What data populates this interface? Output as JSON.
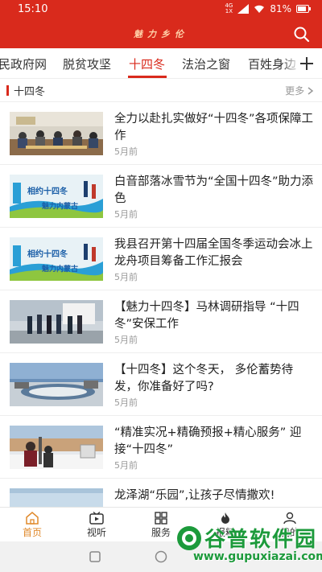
{
  "status_bar": {
    "time": "15:10",
    "network_top": "4G",
    "network_bottom": "1X",
    "battery": "81%"
  },
  "header": {
    "title": "魅力乡伦"
  },
  "tabs": [
    {
      "label": "民政府网",
      "active": false
    },
    {
      "label": "脱贫攻坚",
      "active": false
    },
    {
      "label": "十四冬",
      "active": true
    },
    {
      "label": "法治之窗",
      "active": false
    },
    {
      "label": "百姓身边",
      "active": false
    }
  ],
  "section": {
    "title": "十四冬",
    "more": "更多"
  },
  "articles": [
    {
      "title": "全力以赴扎实做好“十四冬”各项保障工作",
      "date": "5月前",
      "thumb": "meeting-photo"
    },
    {
      "title": "白音部落冰雪节为“全国十四冬”助力添色",
      "date": "5月前",
      "thumb": "winter-games-poster"
    },
    {
      "title": "我县召开第十四届全国冬季运动会冰上龙舟项目筹备工作汇报会",
      "date": "5月前",
      "thumb": "winter-games-poster"
    },
    {
      "title": "【魅力十四冬】马林调研指导 “十四冬”安保工作",
      "date": "5月前",
      "thumb": "inspection-photo"
    },
    {
      "title": "【十四冬】这个冬天， 多伦蓄势待发，你准备好了吗?",
      "date": "5月前",
      "thumb": "aerial-photo"
    },
    {
      "title": "“精准实况+精确预报+精心服务” 迎接“十四冬”",
      "date": "5月前",
      "thumb": "weather-station-photo"
    },
    {
      "title": "龙泽湖“乐园”,让孩子尽情撒欢!",
      "date": "",
      "thumb": "lake-photo"
    }
  ],
  "poster_text": {
    "line1": "相约十四冬",
    "line2": "魅力内蒙古"
  },
  "tabbar": [
    {
      "label": "首页",
      "icon": "home-icon",
      "active": true
    },
    {
      "label": "视听",
      "icon": "tv-icon",
      "active": false
    },
    {
      "label": "服务",
      "icon": "grid-icon",
      "active": false
    },
    {
      "label": "报料",
      "icon": "fire-icon",
      "active": false
    },
    {
      "label": "我的",
      "icon": "user-icon",
      "active": false
    }
  ],
  "watermark": {
    "text": "谷普软件园",
    "url": "www.gupuxiazai.com"
  },
  "colors": {
    "brand": "#d92a1c",
    "active_tabbar": "#e08a2c",
    "watermark": "#1c9a3b"
  }
}
